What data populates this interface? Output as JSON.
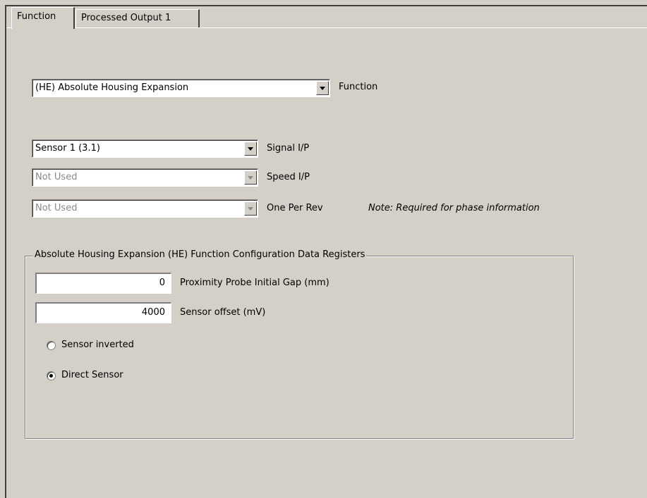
{
  "tabs": [
    {
      "label": "Function"
    },
    {
      "label": "Processed Output 1"
    }
  ],
  "function_select": {
    "value": "(HE)  Absolute Housing Expansion",
    "label": "Function"
  },
  "signal_select": {
    "value": "Sensor 1 (3.1)",
    "label": "Signal I/P"
  },
  "speed_select": {
    "value": "Not Used",
    "label": "Speed I/P"
  },
  "onerev_select": {
    "value": "Not Used",
    "label": "One Per Rev",
    "note": "Note: Required for phase information"
  },
  "group": {
    "title": "Absolute Housing Expansion (HE) Function Configuration Data Registers",
    "gap": {
      "value": "0",
      "label": "Proximity Probe Initial Gap (mm)"
    },
    "offset": {
      "value": "4000",
      "label": "Sensor offset (mV)"
    },
    "radios": [
      {
        "label": "Sensor inverted",
        "selected": false
      },
      {
        "label": "Direct Sensor",
        "selected": true
      }
    ]
  }
}
